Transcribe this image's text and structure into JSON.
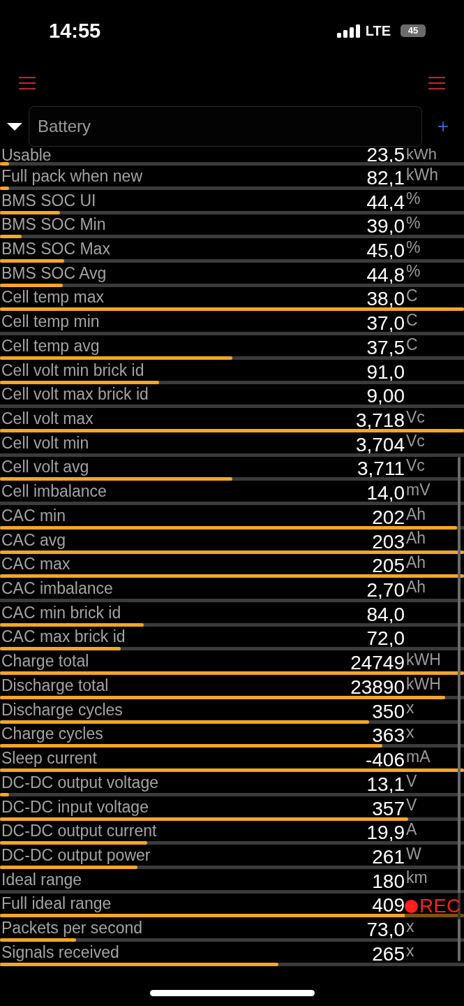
{
  "status_bar": {
    "time": "14:55",
    "network": "LTE",
    "battery_percent": "45"
  },
  "selector": {
    "value": "Battery"
  },
  "metrics": [
    {
      "label": "Usable",
      "value": "23,5",
      "unit": "kWh",
      "level": 0.02
    },
    {
      "label": "Full pack when new",
      "value": "82,1",
      "unit": "kWh",
      "level": 0.02
    },
    {
      "label": "BMS SOC UI",
      "value": "44,4",
      "unit": "%",
      "level": 0.13
    },
    {
      "label": "BMS SOC Min",
      "value": "39,0",
      "unit": "%",
      "level": 0.046
    },
    {
      "label": "BMS SOC Max",
      "value": "45,0",
      "unit": "%",
      "level": 0.138
    },
    {
      "label": "BMS SOC Avg",
      "value": "44,8",
      "unit": "%",
      "level": 0.135
    },
    {
      "label": "Cell temp max",
      "value": "38,0",
      "unit": "C",
      "level": 1
    },
    {
      "label": "Cell temp min",
      "value": "37,0",
      "unit": "C"
    },
    {
      "label": "Cell temp avg",
      "value": "37,5",
      "unit": "C",
      "level": 0.5
    },
    {
      "label": "Cell volt min brick id",
      "value": "91,0",
      "level": 0.343
    },
    {
      "label": "Cell volt max brick id",
      "value": "9,00"
    },
    {
      "label": "Cell volt max",
      "value": "3,718",
      "unit": "Vc",
      "level": 1
    },
    {
      "label": "Cell volt min",
      "value": "3,704",
      "unit": "Vc"
    },
    {
      "label": "Cell volt avg",
      "value": "3,711",
      "unit": "Vc",
      "level": 0.5
    },
    {
      "label": "Cell imbalance",
      "value": "14,0",
      "unit": "mV"
    },
    {
      "label": "CAC min",
      "value": "202",
      "unit": "Ah",
      "level": 0.985
    },
    {
      "label": "CAC avg",
      "value": "203",
      "unit": "Ah",
      "level": 1
    },
    {
      "label": "CAC max",
      "value": "205",
      "unit": "Ah",
      "level": 1
    },
    {
      "label": "CAC imbalance",
      "value": "2,70",
      "unit": "Ah"
    },
    {
      "label": "CAC min brick id",
      "value": "84,0",
      "level": 0.31
    },
    {
      "label": "CAC max brick id",
      "value": "72,0",
      "level": 0.26
    },
    {
      "label": "Charge total",
      "value": "24749",
      "unit": "kWH",
      "level": 1
    },
    {
      "label": "Discharge total",
      "value": "23890",
      "unit": "kWH",
      "level": 0.96
    },
    {
      "label": "Discharge cycles",
      "value": "350",
      "unit": "x",
      "level": 0.795
    },
    {
      "label": "Charge cycles",
      "value": "363",
      "unit": "x",
      "level": 0.824
    },
    {
      "label": "Sleep current",
      "value": "-406",
      "unit": "mA",
      "level": 1
    },
    {
      "label": "DC-DC output voltage",
      "value": "13,1",
      "unit": "V",
      "level": 0.02
    },
    {
      "label": "DC-DC input voltage",
      "value": "357",
      "unit": "V",
      "level": 0.88
    },
    {
      "label": "DC-DC output current",
      "value": "19,9",
      "unit": "A",
      "level": 0.317
    },
    {
      "label": "DC-DC output power",
      "value": "261",
      "unit": "W",
      "level": 0.296
    },
    {
      "label": "Ideal range",
      "value": "180",
      "unit": "km"
    },
    {
      "label": "Full ideal range",
      "value": "409",
      "level": 1
    },
    {
      "label": "Packets per second",
      "value": "73,0",
      "unit": "x",
      "level": 0.164
    },
    {
      "label": "Signals received",
      "value": "265",
      "unit": "x",
      "level": 0.6
    }
  ],
  "recording_indicator": {
    "label": "REC"
  }
}
